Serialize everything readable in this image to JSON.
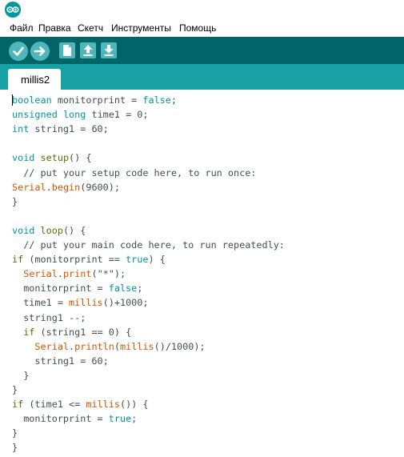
{
  "menu": {
    "items": [
      "Файл",
      "Правка",
      "Скетч",
      "Инструменты",
      "Помощь"
    ]
  },
  "toolbar": {
    "buttons": [
      "verify-icon",
      "upload-icon",
      "new-icon",
      "open-icon",
      "save-icon"
    ]
  },
  "tab": {
    "label": "millis2"
  },
  "colors": {
    "toolbar": "#006468",
    "tabbar": "#17a1a5",
    "button": "#4db7bb",
    "type": "#00979c",
    "keyword": "#5e6d03",
    "function": "#d35400",
    "text": "#434f54"
  },
  "code": {
    "lines": [
      [
        [
          "type",
          "boolean"
        ],
        [
          "pl",
          " monitorprint = "
        ],
        [
          "lit",
          "false"
        ],
        [
          "pl",
          ";"
        ]
      ],
      [
        [
          "type",
          "unsigned"
        ],
        [
          "pl",
          " "
        ],
        [
          "type",
          "long"
        ],
        [
          "pl",
          " time1 = 0;"
        ]
      ],
      [
        [
          "type",
          "int"
        ],
        [
          "pl",
          " string1 = 60;"
        ]
      ],
      [],
      [
        [
          "type",
          "void"
        ],
        [
          "pl",
          " "
        ],
        [
          "kw",
          "setup"
        ],
        [
          "pl",
          "() {"
        ]
      ],
      [
        [
          "cm",
          "  // put your setup code here, to run once:"
        ]
      ],
      [
        [
          "fn",
          "Serial"
        ],
        [
          "pl",
          "."
        ],
        [
          "fn",
          "begin"
        ],
        [
          "pl",
          "(9600);"
        ]
      ],
      [
        [
          "pl",
          "}"
        ]
      ],
      [],
      [
        [
          "type",
          "void"
        ],
        [
          "pl",
          " "
        ],
        [
          "kw",
          "loop"
        ],
        [
          "pl",
          "() {"
        ]
      ],
      [
        [
          "cm",
          "  // put your main code here, to run repeatedly:"
        ]
      ],
      [
        [
          "kw",
          "if"
        ],
        [
          "pl",
          " (monitorprint == "
        ],
        [
          "lit",
          "true"
        ],
        [
          "pl",
          ") {"
        ]
      ],
      [
        [
          "pl",
          "  "
        ],
        [
          "fn",
          "Serial"
        ],
        [
          "pl",
          "."
        ],
        [
          "fn",
          "print"
        ],
        [
          "pl",
          "(\"*\");"
        ]
      ],
      [
        [
          "pl",
          "  monitorprint = "
        ],
        [
          "lit",
          "false"
        ],
        [
          "pl",
          ";"
        ]
      ],
      [
        [
          "pl",
          "  time1 = "
        ],
        [
          "fn",
          "millis"
        ],
        [
          "pl",
          "()+1000;"
        ]
      ],
      [
        [
          "pl",
          "  string1 --;"
        ]
      ],
      [
        [
          "pl",
          "  "
        ],
        [
          "kw",
          "if"
        ],
        [
          "pl",
          " (string1 == 0) {"
        ]
      ],
      [
        [
          "pl",
          "    "
        ],
        [
          "fn",
          "Serial"
        ],
        [
          "pl",
          "."
        ],
        [
          "fn",
          "println"
        ],
        [
          "pl",
          "("
        ],
        [
          "fn",
          "millis"
        ],
        [
          "pl",
          "()/1000);"
        ]
      ],
      [
        [
          "pl",
          "    string1 = 60;"
        ]
      ],
      [
        [
          "pl",
          "  }"
        ]
      ],
      [
        [
          "pl",
          "}"
        ]
      ],
      [
        [
          "kw",
          "if"
        ],
        [
          "pl",
          " (time1 <= "
        ],
        [
          "fn",
          "millis"
        ],
        [
          "pl",
          "()) {"
        ]
      ],
      [
        [
          "pl",
          "  monitorprint = "
        ],
        [
          "lit",
          "true"
        ],
        [
          "pl",
          ";"
        ]
      ],
      [
        [
          "pl",
          "}"
        ]
      ],
      [
        [
          "pl",
          "}"
        ]
      ]
    ]
  }
}
